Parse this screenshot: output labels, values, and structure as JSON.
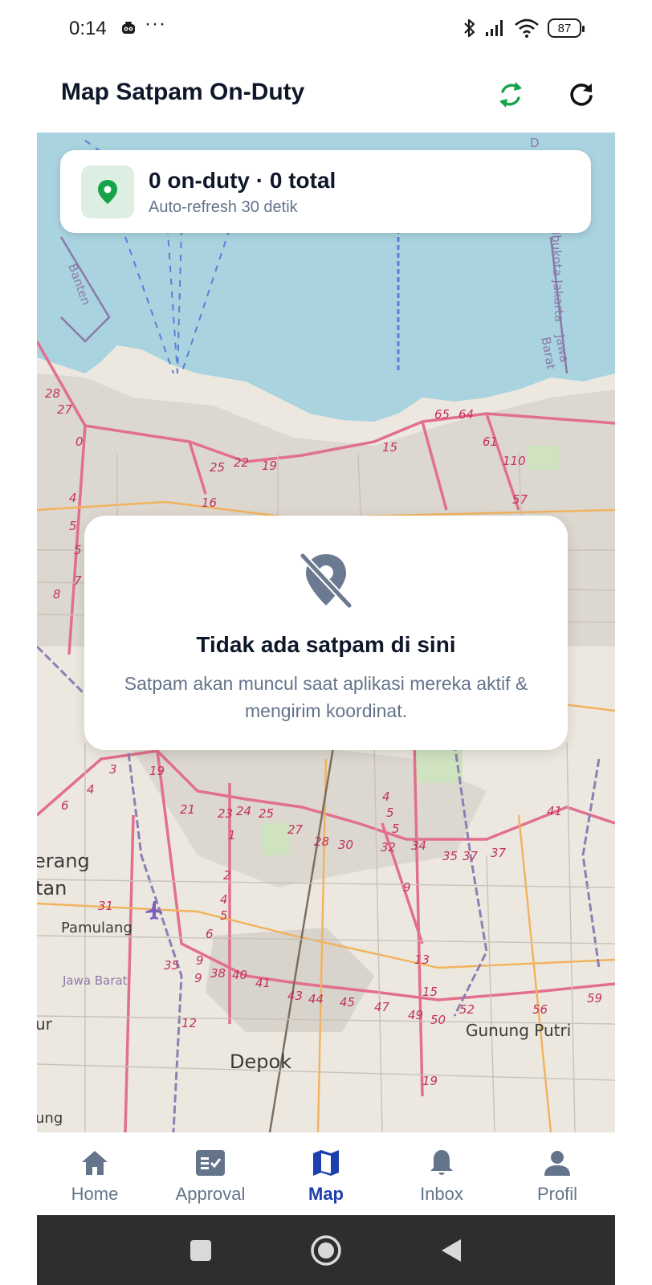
{
  "status_bar": {
    "time": "0:14",
    "more": "···",
    "battery": "87"
  },
  "header": {
    "title": "Map Satpam On-Duty",
    "sync_icon": "sync-icon",
    "refresh_icon": "refresh-icon"
  },
  "summary": {
    "title": "0 on-duty · 0 total",
    "subtitle": "Auto-refresh 30 detik",
    "icon": "location-pin-icon"
  },
  "map": {
    "labels": {
      "banten": "Banten",
      "jawa_barat_top": "Jawa Barat",
      "ibukota": "s Ibukota Jakarta",
      "pamulang": "Pamulang",
      "jawa_barat_left": "Jawa Barat",
      "depok": "Depok",
      "gunung_putri": "Gunung Putri",
      "erang": "erang",
      "tan": "tan",
      "ung": "ung",
      "ur": "ur",
      "d": "D"
    }
  },
  "empty_state": {
    "icon": "location-off-icon",
    "title": "Tidak ada satpam di sini",
    "description": "Satpam akan muncul saat aplikasi mereka aktif & mengirim koordinat."
  },
  "nav": {
    "items": [
      {
        "label": "Home",
        "icon": "home-icon",
        "active": false
      },
      {
        "label": "Approval",
        "icon": "approval-icon",
        "active": false
      },
      {
        "label": "Map",
        "icon": "map-icon",
        "active": true
      },
      {
        "label": "Inbox",
        "icon": "bell-icon",
        "active": false
      },
      {
        "label": "Profil",
        "icon": "person-icon",
        "active": false
      }
    ]
  },
  "colors": {
    "accent": "#1e40af",
    "sync_green": "#16a34a",
    "muted": "#64748b",
    "title": "#0f172a",
    "water": "#a9d3df",
    "land": "#ece8df"
  }
}
